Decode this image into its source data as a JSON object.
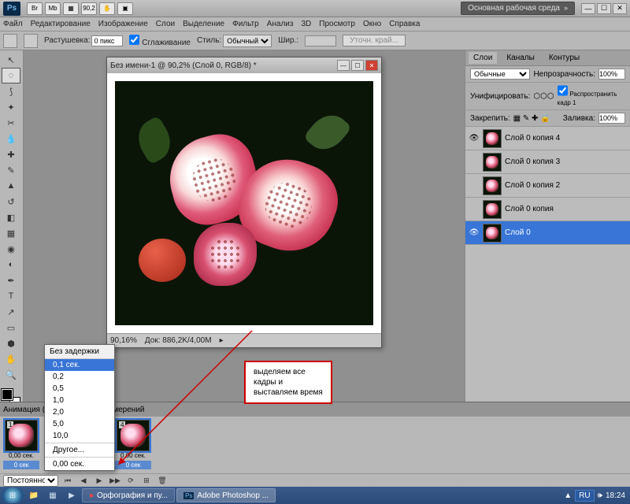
{
  "titlebar": {
    "logo": "Ps",
    "mb_label": "Mb",
    "zoom_display": "90,2",
    "workspace": "Основная рабочая среда"
  },
  "menu": [
    "Файл",
    "Редактирование",
    "Изображение",
    "Слои",
    "Выделение",
    "Фильтр",
    "Анализ",
    "3D",
    "Просмотр",
    "Окно",
    "Справка"
  ],
  "options": {
    "feather_label": "Растушевка:",
    "feather_value": "0 пикс",
    "antialias": "Сглаживание",
    "style_label": "Стиль:",
    "style_value": "Обычный",
    "width_label": "Шир.:",
    "refine": "Уточн. край..."
  },
  "document": {
    "title": "Без имени-1 @ 90,2% (Слой 0, RGB/8) *",
    "zoom": "90,16%",
    "docinfo": "Док: 886,2K/4,00M"
  },
  "layers_panel": {
    "tabs": [
      "Слои",
      "Каналы",
      "Контуры"
    ],
    "blend_mode": "Обычные",
    "opacity_label": "Непрозрачность:",
    "opacity": "100%",
    "unify_label": "Унифицировать:",
    "propagate": "Распространить кадр 1",
    "lock_label": "Закрепить:",
    "fill_label": "Заливка:",
    "fill": "100%",
    "layers": [
      {
        "name": "Слой 0 копия 4",
        "visible": true
      },
      {
        "name": "Слой 0 копия 3",
        "visible": false
      },
      {
        "name": "Слой 0 копия 2",
        "visible": false
      },
      {
        "name": "Слой 0 копия",
        "visible": false
      },
      {
        "name": "Слой 0",
        "visible": true,
        "selected": true
      }
    ]
  },
  "animation": {
    "tab1": "Анимация (ш",
    "tab2": "измерений",
    "frames": [
      {
        "num": "1",
        "time": "0,00 сек.",
        "delay": "0 сек"
      },
      {
        "num": "4",
        "time": "0,00 сек.",
        "delay": "0 сек"
      }
    ],
    "loop": "Постоянно"
  },
  "delay_menu": {
    "title": "Без задержки",
    "items": [
      "0,1 сек.",
      "0,2",
      "0,5",
      "1,0",
      "2,0",
      "5,0",
      "10,0"
    ],
    "other": "Другое...",
    "current": "0,00 сек."
  },
  "callout": {
    "text1": "выделяем все",
    "text2": "кадры и",
    "text3": "выставляем время"
  },
  "taskbar": {
    "task1": "Орфография и пу...",
    "task2": "Adobe Photoshop ...",
    "lang": "RU",
    "time": "18:24"
  }
}
